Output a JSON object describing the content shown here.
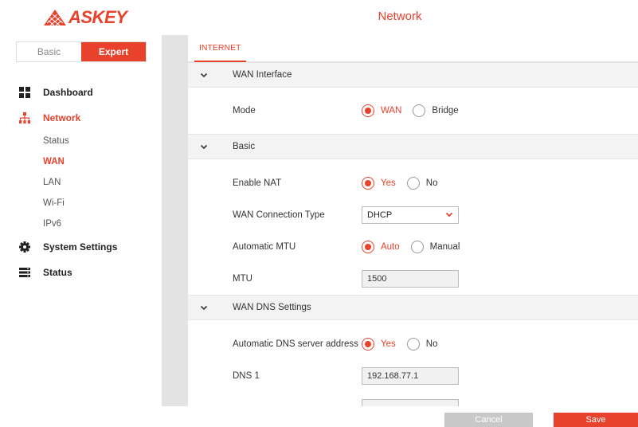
{
  "brand": {
    "name": "ASKEY",
    "accent": "#e8412c"
  },
  "header": {
    "title": "Network"
  },
  "mode_toggle": {
    "basic": "Basic",
    "expert": "Expert",
    "selected": "Expert"
  },
  "sidebar": {
    "items": [
      {
        "label": "Dashboard",
        "icon": "dashboard-icon"
      },
      {
        "label": "Network",
        "icon": "network-icon",
        "active": true,
        "sub": [
          {
            "label": "Status"
          },
          {
            "label": "WAN",
            "active": true
          },
          {
            "label": "LAN"
          },
          {
            "label": "Wi-Fi"
          },
          {
            "label": "IPv6"
          }
        ]
      },
      {
        "label": "System Settings",
        "icon": "gear-icon"
      },
      {
        "label": "Status",
        "icon": "status-icon"
      }
    ]
  },
  "tabs": [
    {
      "label": "INTERNET",
      "active": true
    }
  ],
  "sections": {
    "wan_interface": {
      "title": "WAN Interface",
      "mode": {
        "label": "Mode",
        "options": [
          "WAN",
          "Bridge"
        ],
        "selected": "WAN"
      }
    },
    "basic": {
      "title": "Basic",
      "enable_nat": {
        "label": "Enable NAT",
        "options": [
          "Yes",
          "No"
        ],
        "selected": "Yes"
      },
      "connection_type": {
        "label": "WAN Connection Type",
        "value": "DHCP"
      },
      "auto_mtu": {
        "label": "Automatic MTU",
        "options": [
          "Auto",
          "Manual"
        ],
        "selected": "Auto"
      },
      "mtu": {
        "label": "MTU",
        "value": "1500"
      }
    },
    "dns": {
      "title": "WAN DNS Settings",
      "auto_dns": {
        "label": "Automatic DNS server address",
        "options": [
          "Yes",
          "No"
        ],
        "selected": "Yes"
      },
      "dns1": {
        "label": "DNS 1",
        "value": "192.168.77.1"
      }
    }
  },
  "footer": {
    "cancel": "Cancel",
    "save": "Save"
  }
}
